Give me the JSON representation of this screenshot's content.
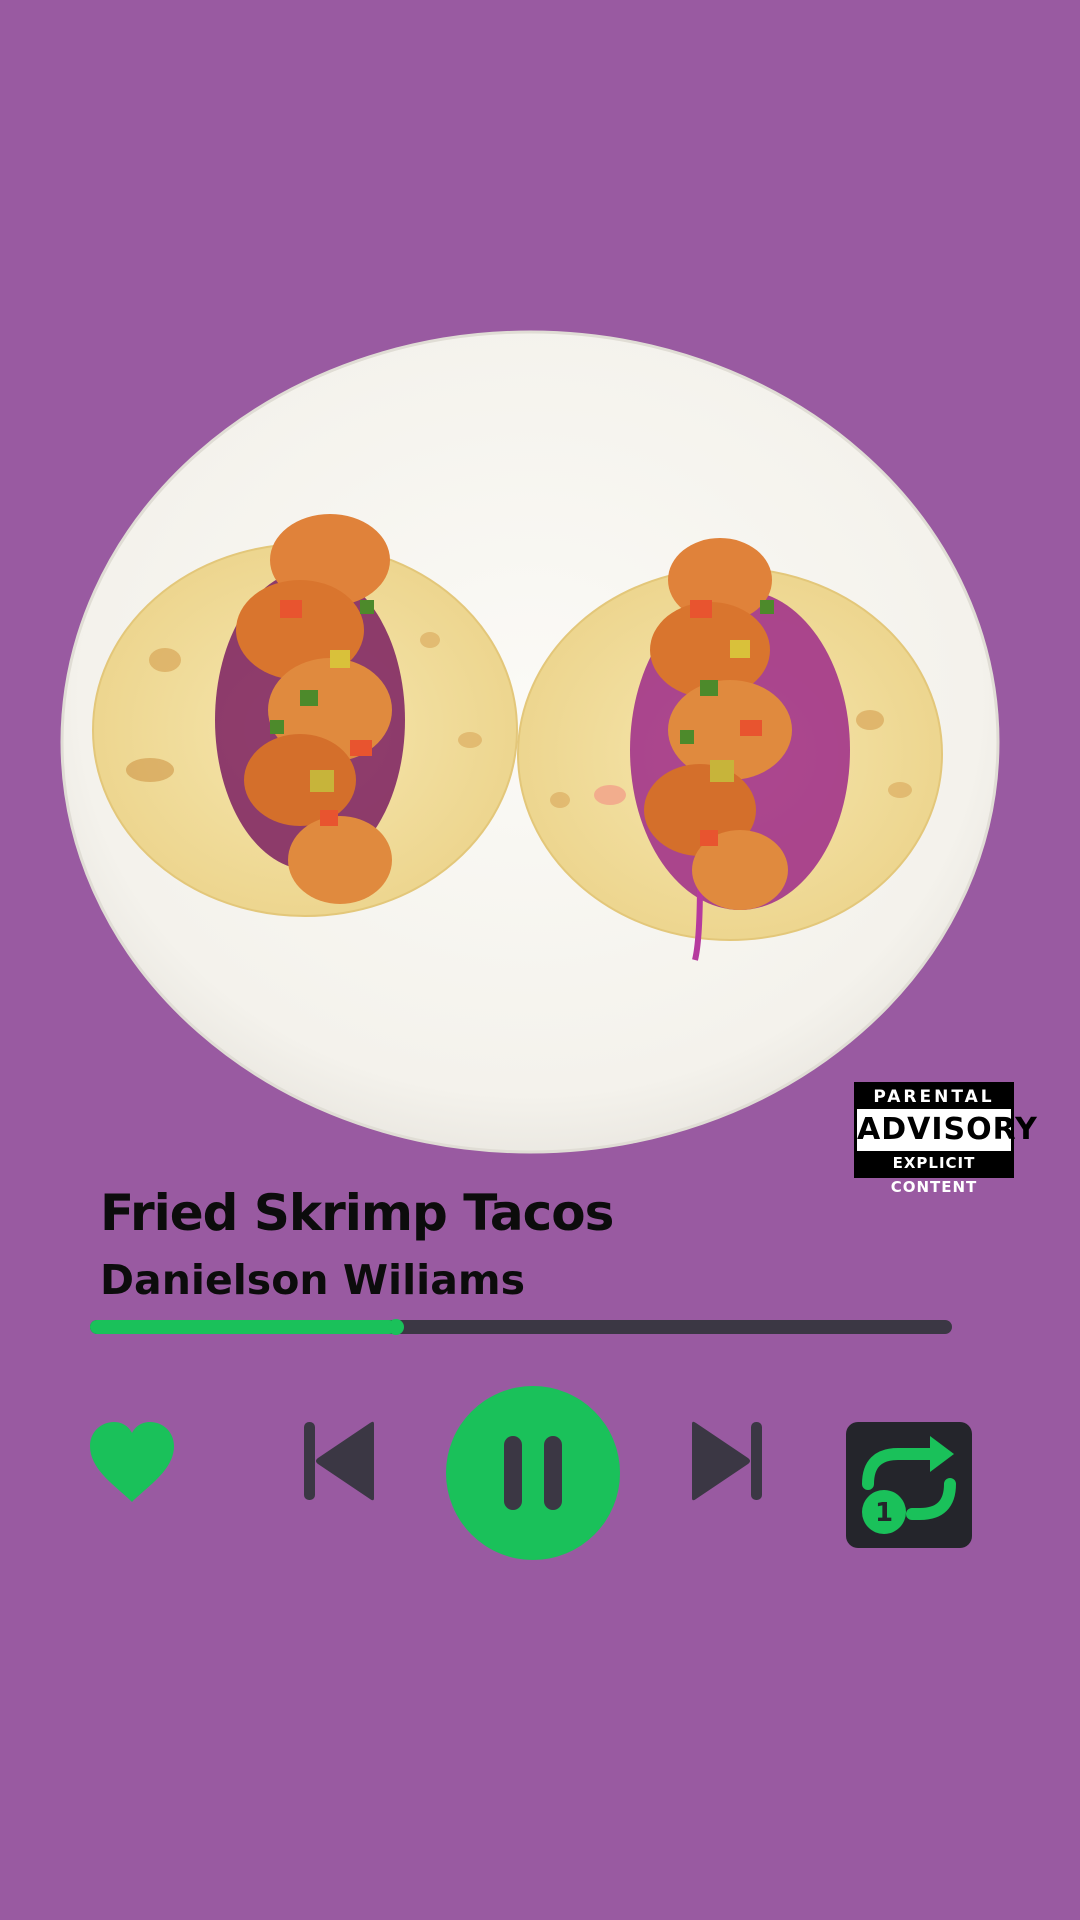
{
  "track": {
    "title": "Fried Skrimp Tacos",
    "artist": "Danielson Wiliams"
  },
  "advisory": {
    "line1": "PARENTAL",
    "line2": "ADVISORY",
    "line3": "EXPLICIT CONTENT"
  },
  "playback": {
    "progress_fraction": 0.355,
    "state": "playing",
    "repeat_mode": "repeat-one",
    "repeat_badge": "1",
    "liked": true
  },
  "icons": {
    "like": "heart-icon",
    "previous": "skip-previous-icon",
    "pause": "pause-icon",
    "next": "skip-next-icon",
    "repeat": "repeat-one-icon"
  },
  "colors": {
    "background": "#995aa1",
    "accent": "#1ac15a",
    "control_dark": "#3b3744",
    "repeat_bg": "#24252b",
    "text": "#0c0c0c"
  }
}
